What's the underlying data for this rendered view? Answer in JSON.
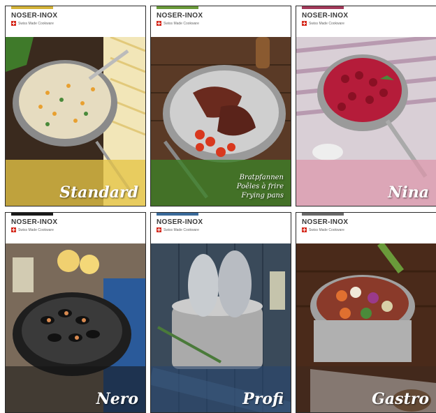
{
  "brochures": [
    {
      "brand": "NOSER-INOX",
      "tagline": "Swiss Made Cookware",
      "title": "Standard",
      "subtitle": [],
      "accent": "#d4b43a",
      "band": "rgba(230,196,70,0.78)"
    },
    {
      "brand": "NOSER-INOX",
      "tagline": "Swiss Made Cookware",
      "title": "",
      "subtitle": [
        "Bratpfannen",
        "Poêles à frire",
        "Frying pans"
      ],
      "accent": "#6a9a3a",
      "band": "rgba(60,130,40,0.78)"
    },
    {
      "brand": "NOSER-INOX",
      "tagline": "Swiss Made Cookware",
      "title": "Nina",
      "subtitle": [],
      "accent": "#a23a5a",
      "band": "rgba(220,150,170,0.72)"
    },
    {
      "brand": "NOSER-INOX",
      "tagline": "Swiss Made Cookware",
      "title": "Nero",
      "subtitle": [],
      "accent": "#1a1a1a",
      "band": "rgba(20,20,20,0.55)"
    },
    {
      "brand": "NOSER-INOX",
      "tagline": "Swiss Made Cookware",
      "title": "Profi",
      "subtitle": [],
      "accent": "#3a6a9a",
      "band": "rgba(40,70,110,0.6)"
    },
    {
      "brand": "NOSER-INOX",
      "tagline": "Swiss Made Cookware",
      "title": "Gastro",
      "subtitle": [],
      "accent": "#6a6a6a",
      "band": "rgba(60,40,30,0.5)"
    }
  ]
}
